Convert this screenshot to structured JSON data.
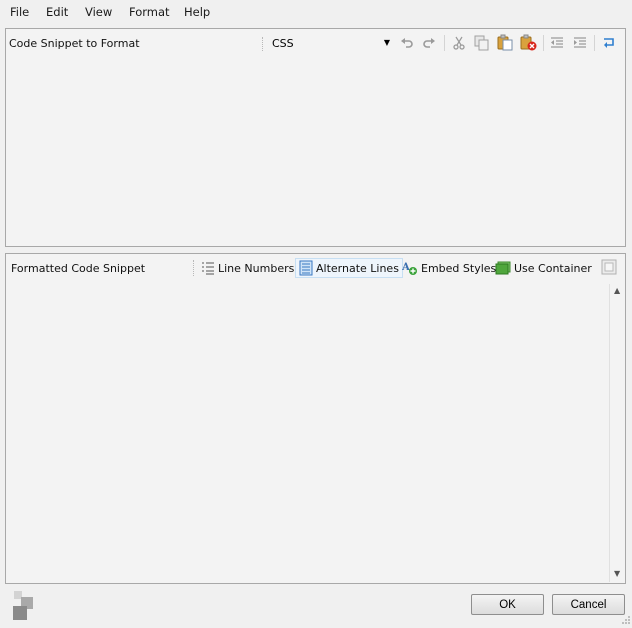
{
  "menu": {
    "file": "File",
    "edit": "Edit",
    "view": "View",
    "format": "Format",
    "help": "Help"
  },
  "input_panel": {
    "label": "Code Snippet to Format",
    "language_selected": "CSS",
    "toolbar_icons": [
      "undo-icon",
      "redo-icon",
      "cut-icon",
      "copy-icon",
      "paste-icon",
      "clear-icon",
      "outdent-icon",
      "indent-icon",
      "word-wrap-icon"
    ]
  },
  "output_panel": {
    "label": "Formatted Code Snippet",
    "options": {
      "line_numbers": "Line Numbers",
      "alternate_lines": "Alternate Lines",
      "embed_styles": "Embed Styles",
      "use_container": "Use Container"
    },
    "copy_icon": "copy-output-icon"
  },
  "buttons": {
    "ok": "OK",
    "cancel": "Cancel"
  },
  "colors": {
    "panel_border": "#a8a8a8",
    "active_option_bg": "#eef5fc",
    "accent_blue": "#2f7fd0"
  }
}
